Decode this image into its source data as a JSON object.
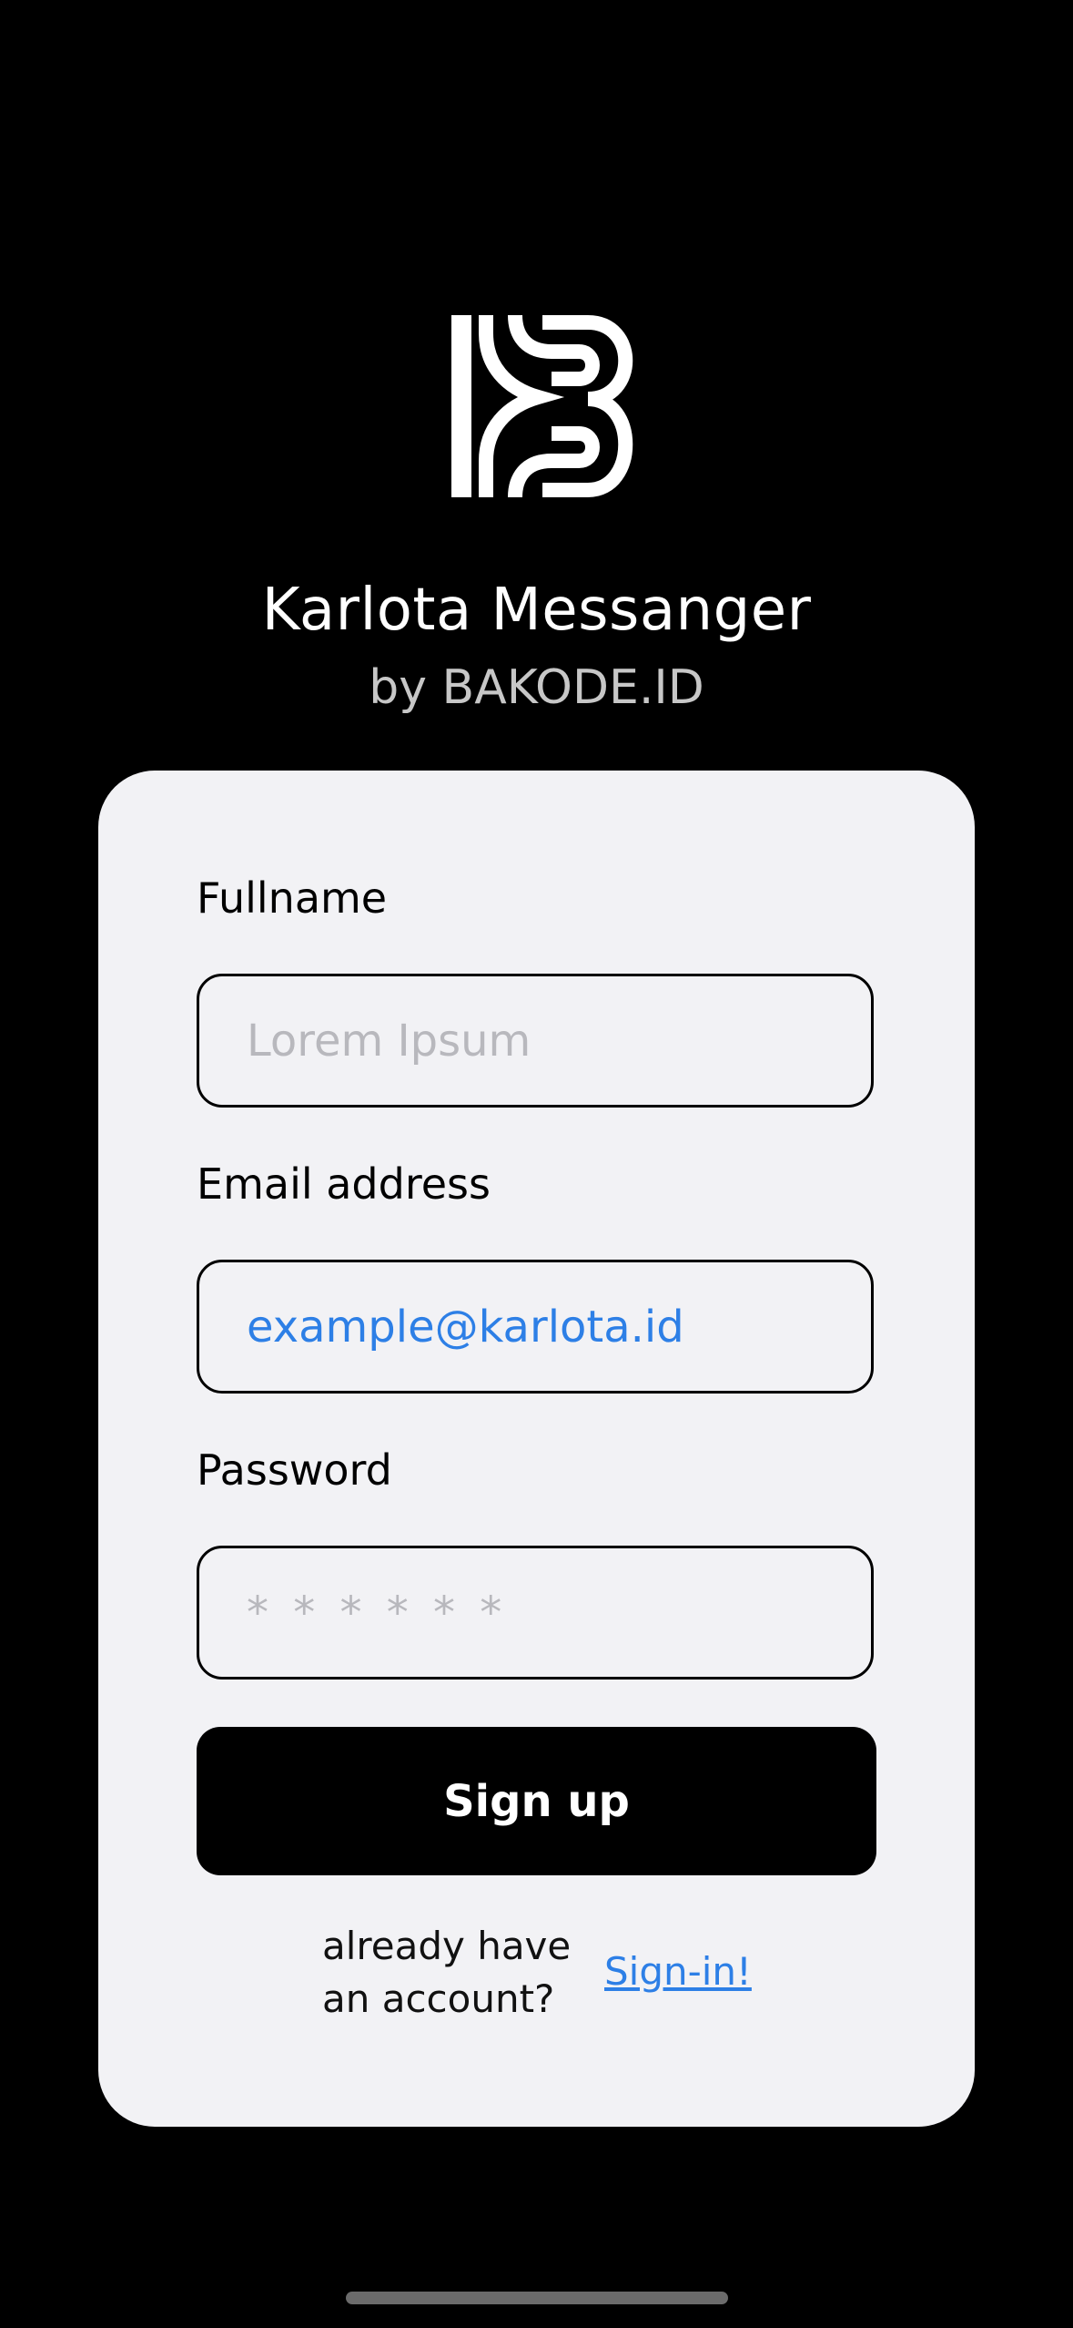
{
  "app": {
    "title": "Karlota Messanger",
    "subtitle": "by BAKODE.ID"
  },
  "form": {
    "fullname": {
      "label": "Fullname",
      "placeholder": "Lorem Ipsum",
      "value": ""
    },
    "email": {
      "label": "Email address",
      "placeholder": "",
      "value": "example@karlota.id"
    },
    "password": {
      "label": "Password",
      "placeholder": "* * * * * *",
      "value": ""
    },
    "signup_label": "Sign up",
    "already_text_line1": "already have",
    "already_text_line2": "an account?",
    "signin_label": "Sign-in!"
  },
  "colors": {
    "background": "#000000",
    "card": "#f2f2f5",
    "link": "#2d7fe6",
    "button": "#000000",
    "placeholder": "#b8b8bd"
  },
  "icons": {
    "logo": "bakode-logo-icon"
  }
}
